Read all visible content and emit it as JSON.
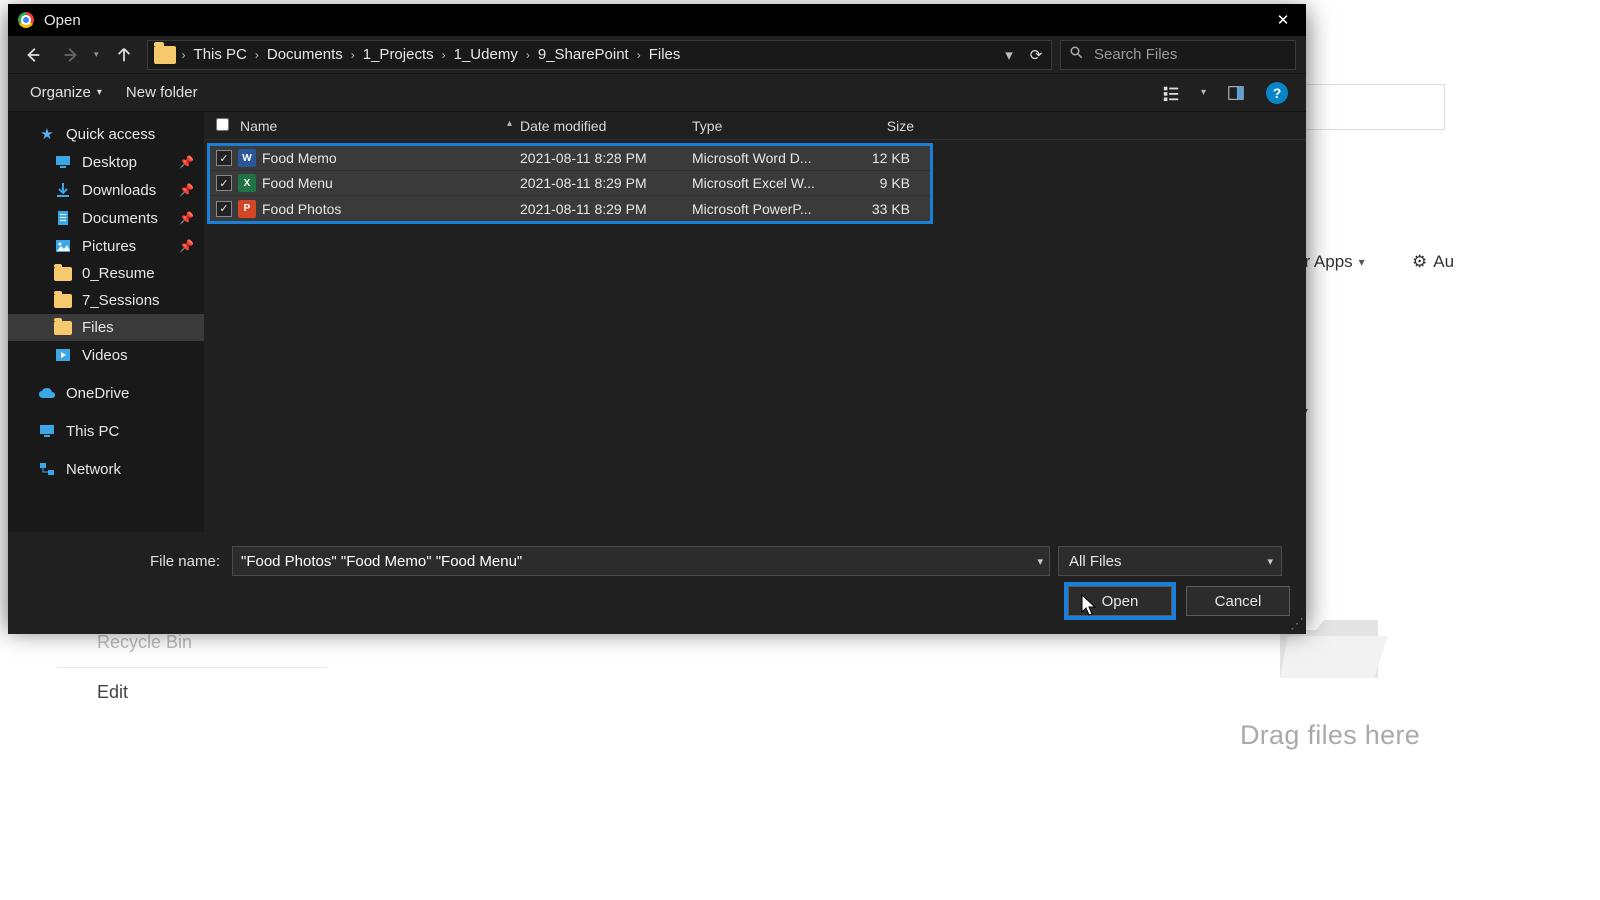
{
  "titlebar": {
    "title": "Open",
    "close_label": "✕"
  },
  "breadcrumb": {
    "items": [
      "This PC",
      "Documents",
      "1_Projects",
      "1_Udemy",
      "9_SharePoint",
      "Files"
    ]
  },
  "search": {
    "placeholder": "Search Files"
  },
  "toolbar": {
    "organize": "Organize",
    "new_folder": "New folder",
    "help_glyph": "?"
  },
  "sidenav": {
    "quick_access": "Quick access",
    "items_pinned": [
      "Desktop",
      "Downloads",
      "Documents",
      "Pictures"
    ],
    "items_recent": [
      "0_Resume",
      "7_Sessions",
      "Files",
      "Videos"
    ],
    "onedrive": "OneDrive",
    "thispc": "This PC",
    "network": "Network"
  },
  "columns": {
    "name": "Name",
    "date": "Date modified",
    "type": "Type",
    "size": "Size"
  },
  "files": [
    {
      "name": "Food Memo",
      "date": "2021-08-11 8:28 PM",
      "type": "Microsoft Word D...",
      "size": "12 KB",
      "app": "word"
    },
    {
      "name": "Food Menu",
      "date": "2021-08-11 8:29 PM",
      "type": "Microsoft Excel W...",
      "size": "9 KB",
      "app": "excel"
    },
    {
      "name": "Food Photos",
      "date": "2021-08-11 8:29 PM",
      "type": "Microsoft PowerP...",
      "size": "33 KB",
      "app": "ppt"
    }
  ],
  "footer": {
    "filename_label": "File name:",
    "filename_value": "\"Food Photos\" \"Food Memo\" \"Food Menu\"",
    "type_filter": "All Files",
    "open": "Open",
    "cancel": "Cancel"
  },
  "background": {
    "apps_label": "er Apps",
    "auto_label": "Au",
    "recycle": "Recycle Bin",
    "edit": "Edit",
    "drag_text": "Drag files here"
  }
}
